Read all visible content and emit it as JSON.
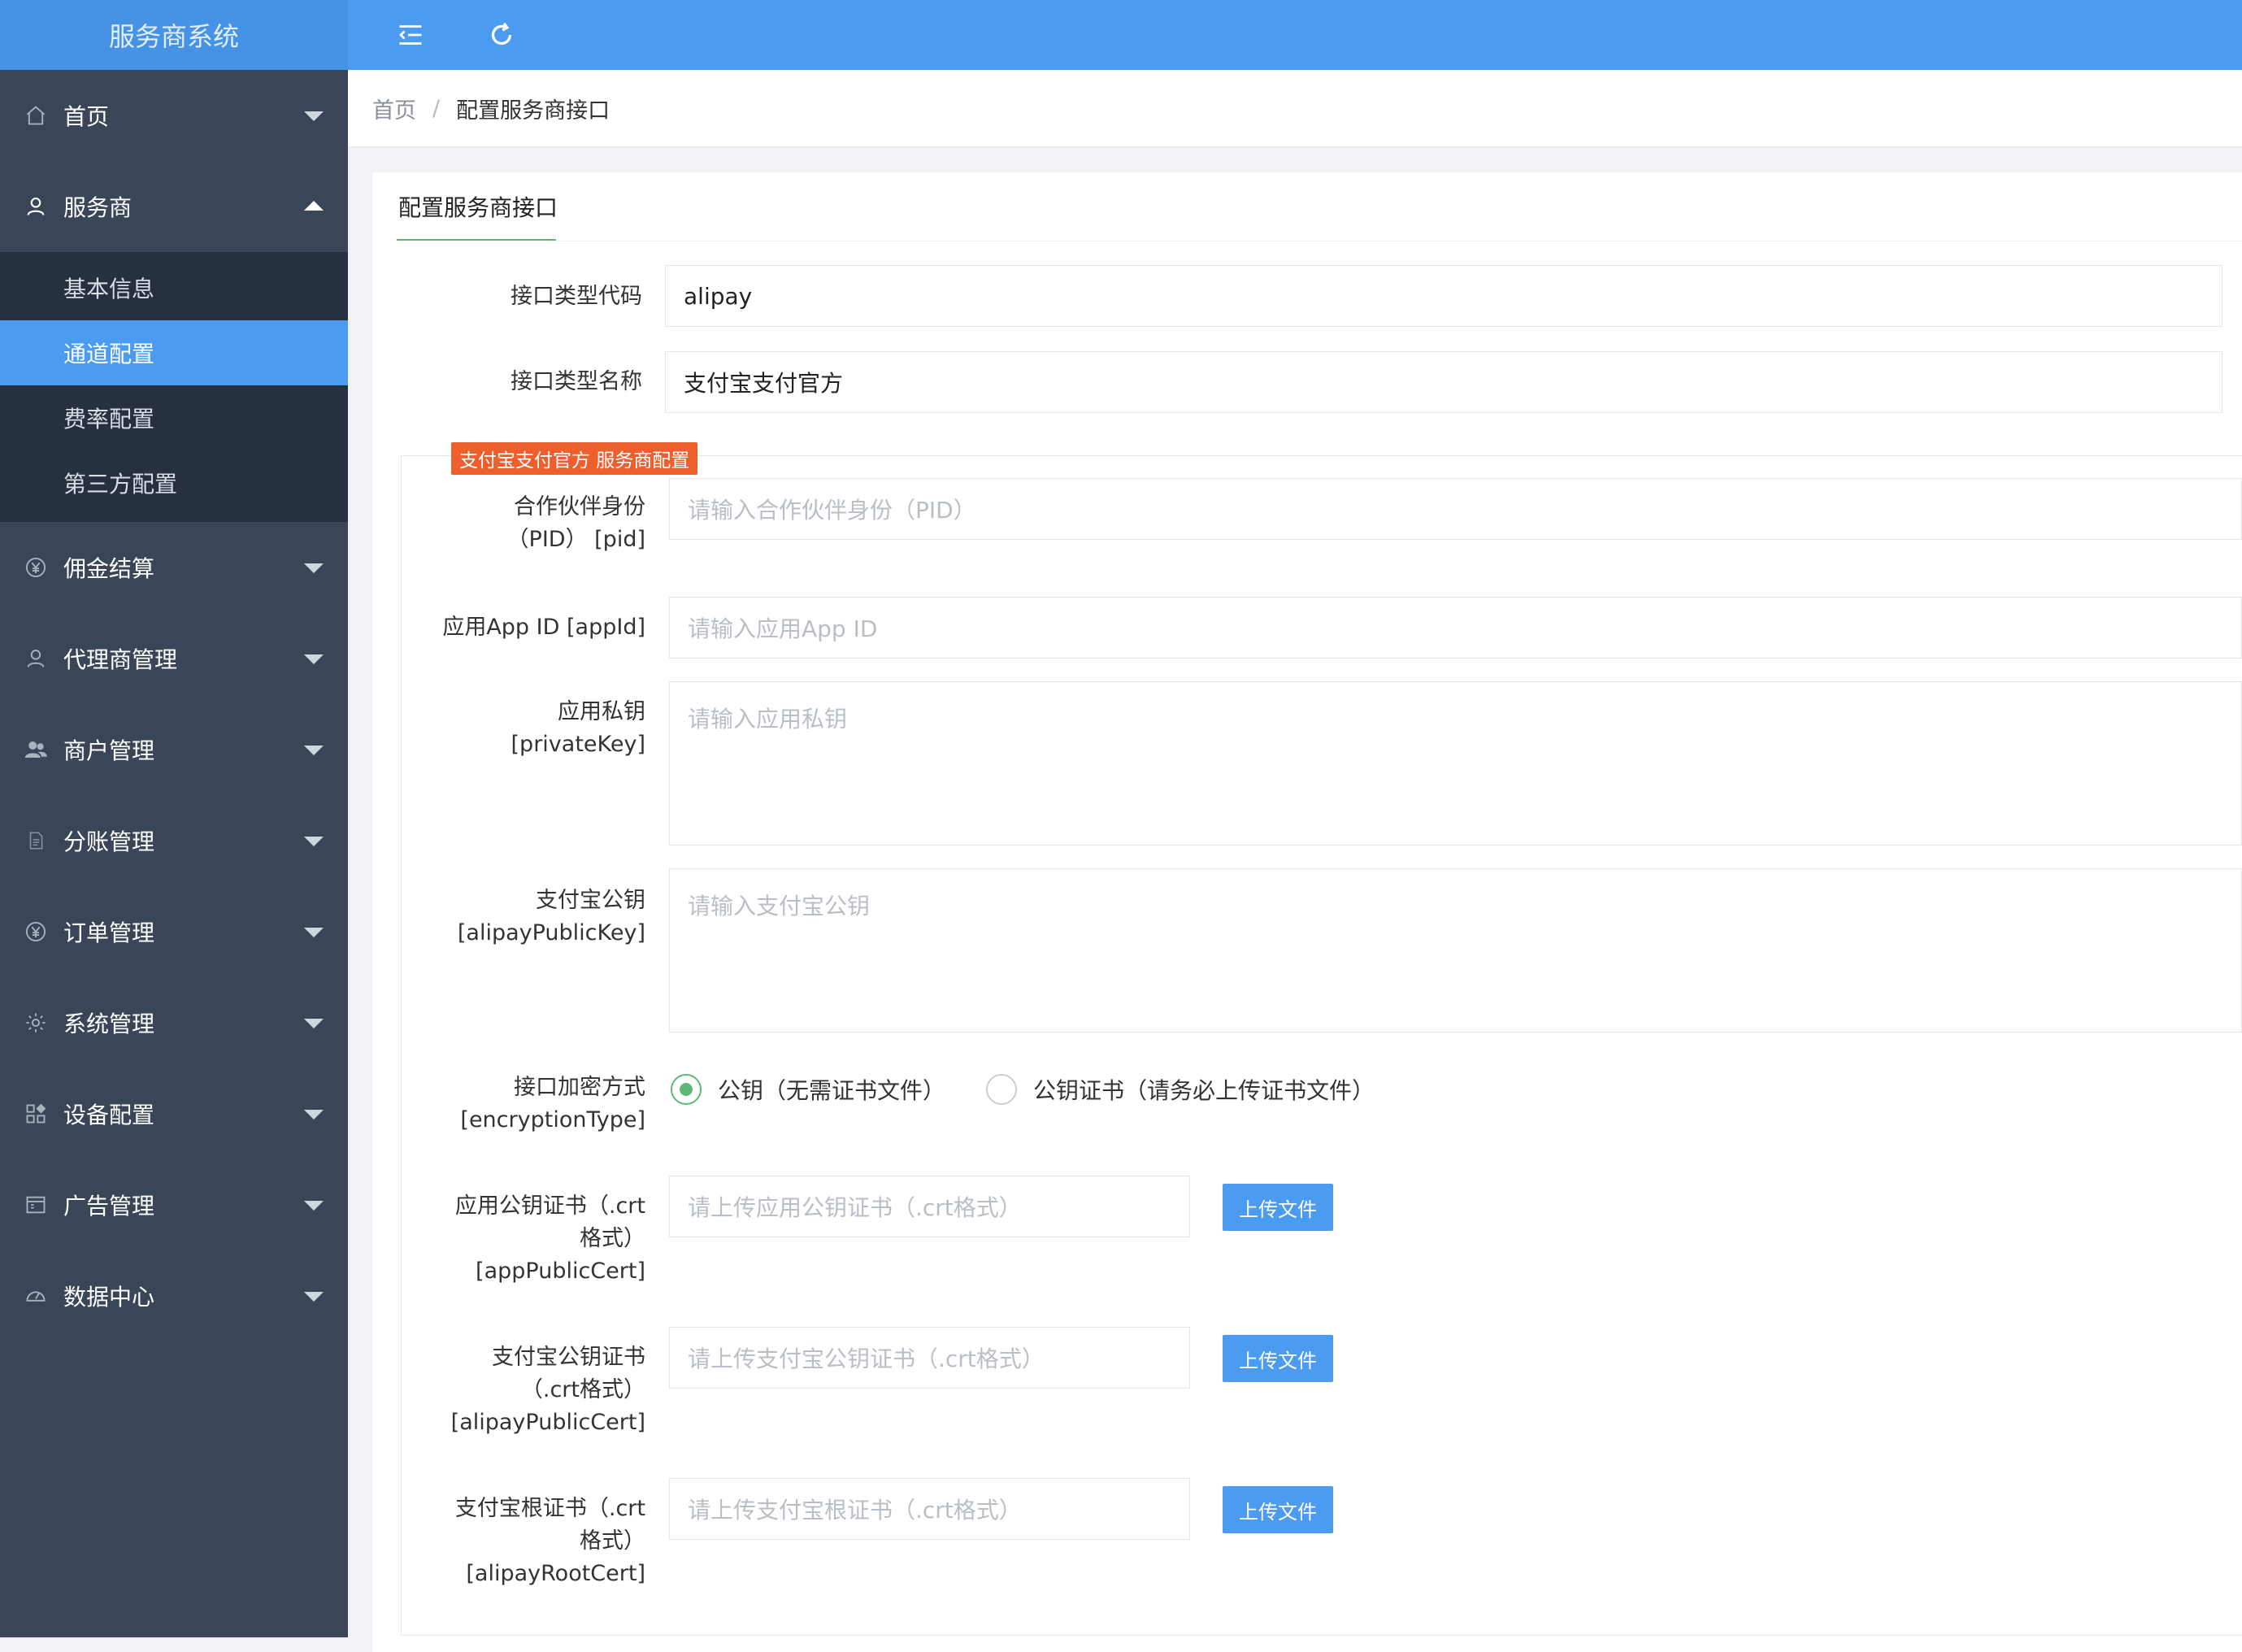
{
  "app": {
    "title": "服务商系统"
  },
  "sidebar": {
    "items": [
      {
        "label": "首页",
        "icon": "home-icon",
        "expanded": false
      },
      {
        "label": "服务商",
        "icon": "user-icon",
        "expanded": true,
        "children": [
          {
            "label": "基本信息",
            "active": false
          },
          {
            "label": "通道配置",
            "active": true
          },
          {
            "label": "费率配置",
            "active": false
          },
          {
            "label": "第三方配置",
            "active": false
          }
        ]
      },
      {
        "label": "佣金结算",
        "icon": "yen-icon",
        "expanded": false
      },
      {
        "label": "代理商管理",
        "icon": "user-icon",
        "expanded": false
      },
      {
        "label": "商户管理",
        "icon": "users-icon",
        "expanded": false
      },
      {
        "label": "分账管理",
        "icon": "document-icon",
        "expanded": false
      },
      {
        "label": "订单管理",
        "icon": "yen-icon",
        "expanded": false
      },
      {
        "label": "系统管理",
        "icon": "gear-icon",
        "expanded": false
      },
      {
        "label": "设备配置",
        "icon": "apps-icon",
        "expanded": false
      },
      {
        "label": "广告管理",
        "icon": "window-icon",
        "expanded": false
      },
      {
        "label": "数据中心",
        "icon": "dashboard-icon",
        "expanded": false
      }
    ]
  },
  "topbar": {
    "icons": [
      "menu-fold-icon",
      "refresh-icon"
    ]
  },
  "breadcrumb": {
    "home": "首页",
    "separator": "/",
    "current": "配置服务商接口"
  },
  "panel": {
    "tab": "配置服务商接口"
  },
  "form": {
    "ifCode": {
      "label": "接口类型代码",
      "value": "alipay"
    },
    "ifName": {
      "label": "接口类型名称",
      "value": "支付宝支付官方"
    },
    "legend": "支付宝支付官方 服务商配置",
    "pid": {
      "label_1": "合作伙伴身份",
      "label_2": "（PID） [pid]",
      "placeholder": "请输入合作伙伴身份（PID）"
    },
    "appId": {
      "label": "应用App ID [appId]",
      "placeholder": "请输入应用App ID"
    },
    "privateKey": {
      "label_1": "应用私钥",
      "label_2": "[privateKey]",
      "placeholder": "请输入应用私钥"
    },
    "alipayPublicKey": {
      "label_1": "支付宝公钥",
      "label_2": "[alipayPublicKey]",
      "placeholder": "请输入支付宝公钥"
    },
    "encryptionType": {
      "label_1": "接口加密方式",
      "label_2": "[encryptionType]",
      "options": [
        {
          "label": "公钥（无需证书文件）",
          "checked": true
        },
        {
          "label": "公钥证书（请务必上传证书文件）",
          "checked": false
        }
      ]
    },
    "appPublicCert": {
      "label_1": "应用公钥证书（.crt",
      "label_2": "格式）",
      "label_3": "[appPublicCert]",
      "placeholder": "请上传应用公钥证书（.crt格式）",
      "button": "上传文件"
    },
    "alipayPublicCert": {
      "label_1": "支付宝公钥证书",
      "label_2": "（.crt格式）",
      "label_3": "[alipayPublicCert]",
      "placeholder": "请上传支付宝公钥证书（.crt格式）",
      "button": "上传文件"
    },
    "alipayRootCert": {
      "label_1": "支付宝根证书（.crt",
      "label_2": "格式）",
      "label_3": "[alipayRootCert]",
      "placeholder": "请上传支付宝根证书（.crt格式）",
      "button": "上传文件"
    }
  },
  "colors": {
    "primary": "#4b9cf0",
    "sidebar": "#3a4658",
    "submenu": "#273040",
    "success": "#5fb878",
    "legend": "#ee5f2e"
  }
}
